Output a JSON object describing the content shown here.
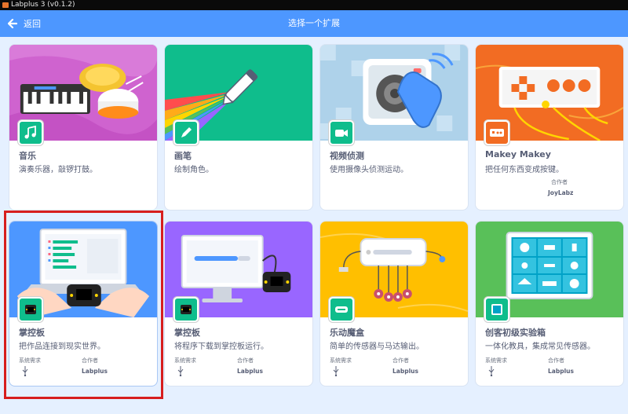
{
  "window": {
    "title": "Labplus 3 (v0.1.2)"
  },
  "header": {
    "back_label": "返回",
    "title": "选择一个扩展"
  },
  "cards": [
    {
      "title": "音乐",
      "description": "演奏乐器，敲锣打鼓。",
      "icon": "music-note-icon"
    },
    {
      "title": "画笔",
      "description": "绘制角色。",
      "icon": "pen-icon"
    },
    {
      "title": "视频侦测",
      "description": "使用摄像头侦测运动。",
      "icon": "video-camera-icon"
    },
    {
      "title": "Makey Makey",
      "description": "把任何东西变成按键。",
      "collaborator_label": "合作者",
      "collaborator": "JoyLabz",
      "icon": "makey-makey-icon"
    },
    {
      "title": "掌控板",
      "description": "把作品连接到现实世界。",
      "requirements_label": "系统需求",
      "requirement_icon": "usb-icon",
      "collaborator_label": "合作者",
      "collaborator": "Labplus",
      "icon": "board-icon"
    },
    {
      "title": "掌控板",
      "description": "将程序下载到掌控板运行。",
      "requirements_label": "系统需求",
      "requirement_icon": "usb-icon",
      "collaborator_label": "合作者",
      "collaborator": "Labplus",
      "icon": "board-icon"
    },
    {
      "title": "乐动魔盒",
      "description": "简单的传感器与马达输出。",
      "requirements_label": "系统需求",
      "requirement_icon": "usb-icon",
      "collaborator_label": "合作者",
      "collaborator": "Labplus",
      "icon": "magic-box-icon"
    },
    {
      "title": "创客初级实验箱",
      "description": "一体化教具，集成常见传感器。",
      "requirements_label": "系统需求",
      "requirement_icon": "usb-icon",
      "collaborator_label": "合作者",
      "collaborator": "Labplus",
      "icon": "maker-kit-icon"
    }
  ],
  "selected_card": 4
}
